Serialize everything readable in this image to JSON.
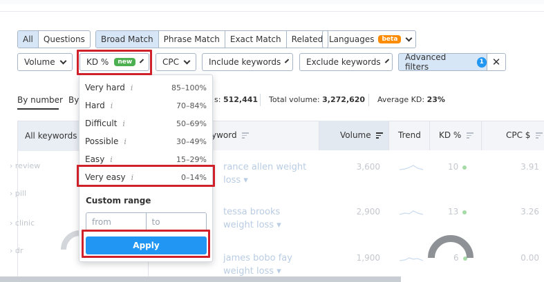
{
  "tabs_left": [
    {
      "label": "All",
      "active": true
    },
    {
      "label": "Questions",
      "active": false
    }
  ],
  "match_tabs": [
    {
      "label": "Broad Match",
      "active": true
    },
    {
      "label": "Phrase Match",
      "active": false
    },
    {
      "label": "Exact Match",
      "active": false
    },
    {
      "label": "Related",
      "active": false
    }
  ],
  "languages": {
    "label": "Languages",
    "badge": "beta"
  },
  "filters": {
    "volume": "Volume",
    "kd": "KD %",
    "kd_badge": "new",
    "cpc": "CPC",
    "include": "Include keywords",
    "exclude": "Exclude keywords",
    "advanced": "Advanced filters",
    "advanced_count": "1",
    "close": "✕"
  },
  "view_tabs": {
    "by_number": "By number",
    "by_other": "By"
  },
  "stats": {
    "keywords_suffix": "s:",
    "keywords_value": "512,441",
    "total_volume_label": "Total volume:",
    "total_volume_value": "3,272,620",
    "avg_kd_label": "Average KD:",
    "avg_kd_value": "23%"
  },
  "sidebar": {
    "header": "All keywords",
    "items": [
      "review",
      "pill",
      "clinic",
      "dr"
    ]
  },
  "table": {
    "columns": {
      "keyword": "yword",
      "volume": "Volume",
      "trend": "Trend",
      "kd": "KD %",
      "cpc": "CPC $"
    },
    "rows": [
      {
        "kw1": "rance allen weight",
        "kw2": "loss",
        "volume": "3,600",
        "kd": "10",
        "cpc": "3.91"
      },
      {
        "kw1": "tessa brooks",
        "kw2": "weight loss",
        "volume": "2,900",
        "kd": "13",
        "cpc": "3.26"
      },
      {
        "kw1": "james bobo fay",
        "kw2": "weight loss",
        "volume": "1,900",
        "kd": "6",
        "cpc": "0.00"
      }
    ]
  },
  "kd_menu": {
    "items": [
      {
        "label": "Very hard",
        "range": "85–100%"
      },
      {
        "label": "Hard",
        "range": "70–84%"
      },
      {
        "label": "Difficult",
        "range": "50–69%"
      },
      {
        "label": "Possible",
        "range": "30–49%"
      },
      {
        "label": "Easy",
        "range": "15–29%"
      },
      {
        "label": "Very easy",
        "range": "0–14%"
      }
    ],
    "info_glyph": "i",
    "custom_range": "Custom range",
    "from_placeholder": "from",
    "to_placeholder": "to",
    "apply": "Apply"
  },
  "colors": {
    "accent": "#2196f3",
    "highlight": "#d0202a",
    "active_tab": "#d7e6f6",
    "beta": "#ff8c00",
    "new": "#4caf50"
  }
}
